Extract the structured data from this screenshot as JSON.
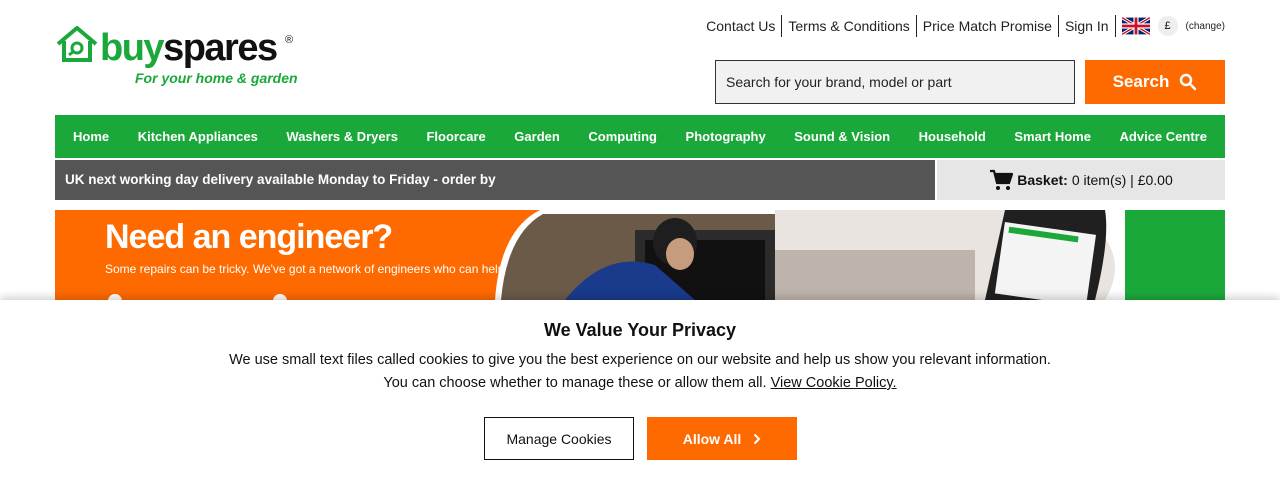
{
  "brand": {
    "name_part1": "buy",
    "name_part2": "spares",
    "registered": "®",
    "tagline": "For your home & garden",
    "color_green": "#1ba83a",
    "color_orange": "#ff6a00"
  },
  "toplinks": {
    "contact": "Contact Us",
    "terms": "Terms & Conditions",
    "price_match": "Price Match Promise",
    "sign_in": "Sign In",
    "flag_icon": "uk-flag-icon",
    "currency": "£",
    "change": "(change)"
  },
  "search": {
    "placeholder": "Search for your brand, model or part",
    "button_label": "Search",
    "icon": "search-icon"
  },
  "nav": {
    "items": [
      "Home",
      "Kitchen Appliances",
      "Washers & Dryers",
      "Floorcare",
      "Garden",
      "Computing",
      "Photography",
      "Sound & Vision",
      "Household",
      "Smart Home",
      "Advice Centre"
    ]
  },
  "delivery": {
    "text": "UK next working day delivery available Monday to Friday - order by"
  },
  "basket": {
    "label": "Basket:",
    "summary": "0 item(s) | £0.00",
    "icon": "cart-icon"
  },
  "banner": {
    "title": "Need an engineer?",
    "subtitle": "Some repairs can be tricky. We've got a network of engineers who can help."
  },
  "cookie": {
    "title": "We Value Your Privacy",
    "line1": "We use small text files called cookies to give you the best experience on our website and help us show you relevant information.",
    "line2": "You can choose whether to manage these or allow them all.",
    "policy_link": "View Cookie Policy.",
    "manage_label": "Manage Cookies",
    "allow_label": "Allow All"
  }
}
